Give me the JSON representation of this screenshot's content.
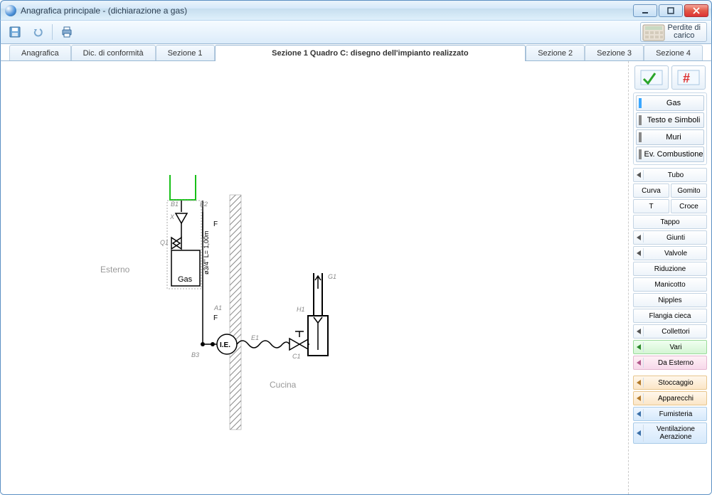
{
  "window": {
    "title": "Anagrafica principale - (dichiarazione a gas)"
  },
  "toolbar": {
    "perdite_label": "Perdite di\ncarico"
  },
  "tabs": [
    {
      "label": "Anagrafica"
    },
    {
      "label": "Dic. di conformità"
    },
    {
      "label": "Sezione 1"
    },
    {
      "label": "Sezione 1 Quadro C: disegno dell'impianto realizzato",
      "active": true
    },
    {
      "label": "Sezione 2"
    },
    {
      "label": "Sezione 3"
    },
    {
      "label": "Sezione 4"
    }
  ],
  "canvas": {
    "labels": {
      "esterno": "Esterno",
      "cucina": "Cucina",
      "gas_box": "Gas",
      "ie": "I.E."
    },
    "node_labels": {
      "b1": "B1",
      "b2": "B2",
      "b3": "B3",
      "q1": "Q1",
      "x": "X",
      "a1": "A1",
      "e1": "E1",
      "c1": "C1",
      "h1": "H1",
      "g1": "G1",
      "f_top": "F",
      "f_bottom": "F",
      "pipe_dim": "ø3/4\" L= 1,00m"
    }
  },
  "palette": {
    "categories": [
      {
        "id": "gas",
        "label": "Gas",
        "active": true
      },
      {
        "id": "testo",
        "label": "Testo e Simboli"
      },
      {
        "id": "muri",
        "label": "Muri"
      },
      {
        "id": "evcomb",
        "label": "Ev. Combustione"
      }
    ],
    "items": {
      "tubo": "Tubo",
      "curva": "Curva",
      "gomito": "Gomito",
      "t": "T",
      "croce": "Croce",
      "tappo": "Tappo",
      "giunti": "Giunti",
      "valvole": "Valvole",
      "riduzione": "Riduzione",
      "manicotto": "Manicotto",
      "nipples": "Nipples",
      "flangia": "Flangia cieca",
      "collettori": "Collettori",
      "vari": "Vari",
      "daesterno": "Da Esterno",
      "stoccaggio": "Stoccaggio",
      "apparecchi": "Apparecchi",
      "fumisteria": "Fumisteria",
      "ventilazione": "Ventilazione Aerazione"
    }
  }
}
